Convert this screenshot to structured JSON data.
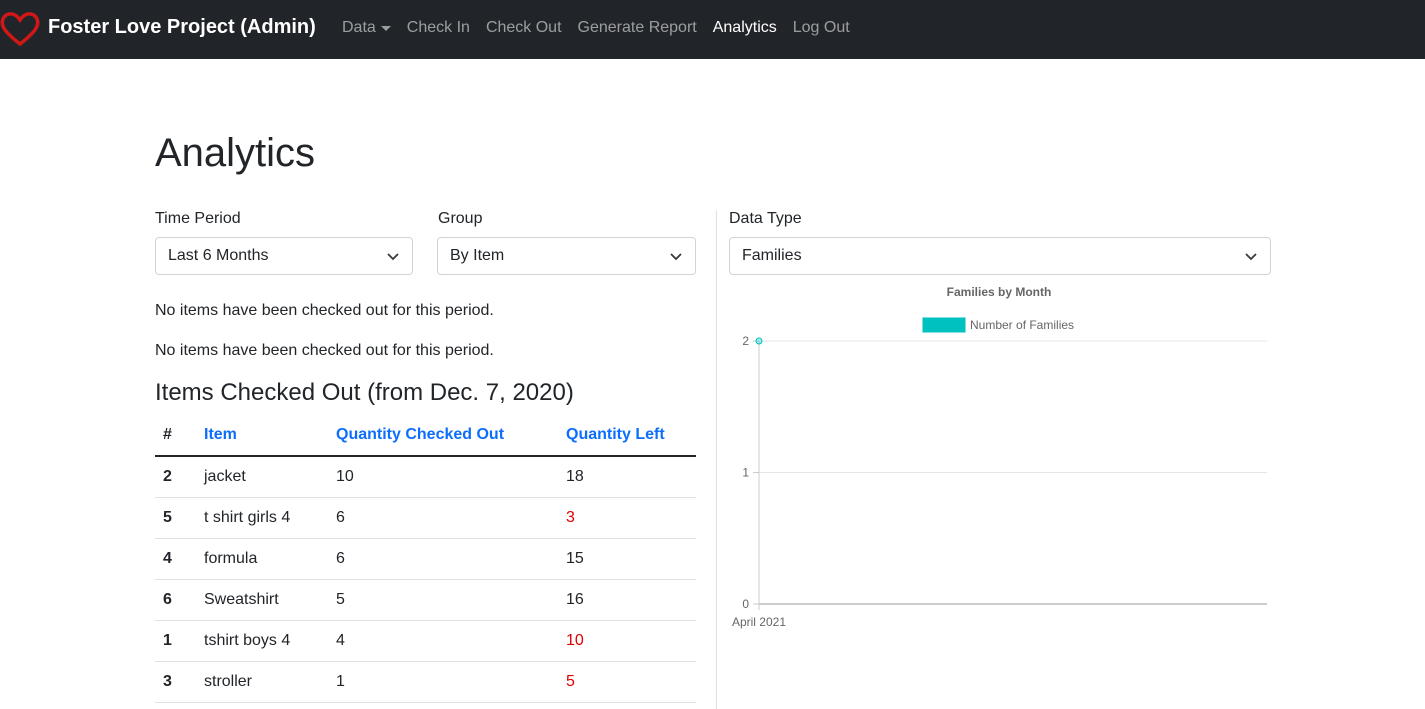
{
  "navbar": {
    "brand": "Foster Love Project (Admin)",
    "links": [
      {
        "label": "Data",
        "dropdown": true,
        "active": false
      },
      {
        "label": "Check In",
        "active": false
      },
      {
        "label": "Check Out",
        "active": false
      },
      {
        "label": "Generate Report",
        "active": false
      },
      {
        "label": "Analytics",
        "active": true
      },
      {
        "label": "Log Out",
        "active": false
      }
    ]
  },
  "page": {
    "title": "Analytics"
  },
  "filters": {
    "time_period": {
      "label": "Time Period",
      "value": "Last 6 Months"
    },
    "group": {
      "label": "Group",
      "value": "By Item"
    },
    "data_type": {
      "label": "Data Type",
      "value": "Families"
    }
  },
  "messages": [
    "No items have been checked out for this period.",
    "No items have been checked out for this period."
  ],
  "table": {
    "title": "Items Checked Out (from Dec. 7, 2020)",
    "columns": [
      "#",
      "Item",
      "Quantity Checked Out",
      "Quantity Left"
    ],
    "rows": [
      {
        "id": "2",
        "item": "jacket",
        "checked_out": "10",
        "left": "18",
        "low": false
      },
      {
        "id": "5",
        "item": "t shirt girls 4",
        "checked_out": "6",
        "left": "3",
        "low": true
      },
      {
        "id": "4",
        "item": "formula",
        "checked_out": "6",
        "left": "15",
        "low": false
      },
      {
        "id": "6",
        "item": "Sweatshirt",
        "checked_out": "5",
        "left": "16",
        "low": false
      },
      {
        "id": "1",
        "item": "tshirt boys 4",
        "checked_out": "4",
        "left": "10",
        "low": true
      },
      {
        "id": "3",
        "item": "stroller",
        "checked_out": "1",
        "left": "5",
        "low": true
      }
    ]
  },
  "colors": {
    "low_stock": "#e00000",
    "series": "#00c0c0",
    "link": "#0d6efd",
    "navbar": "#212529"
  },
  "chart_data": {
    "type": "line",
    "title": "Families by Month",
    "categories": [
      "April 2021"
    ],
    "series": [
      {
        "name": "Number of Families",
        "values": [
          2
        ]
      }
    ],
    "ylim": [
      0,
      2
    ],
    "yticks": [
      0,
      1,
      2
    ],
    "grid": true,
    "legend": "top"
  }
}
